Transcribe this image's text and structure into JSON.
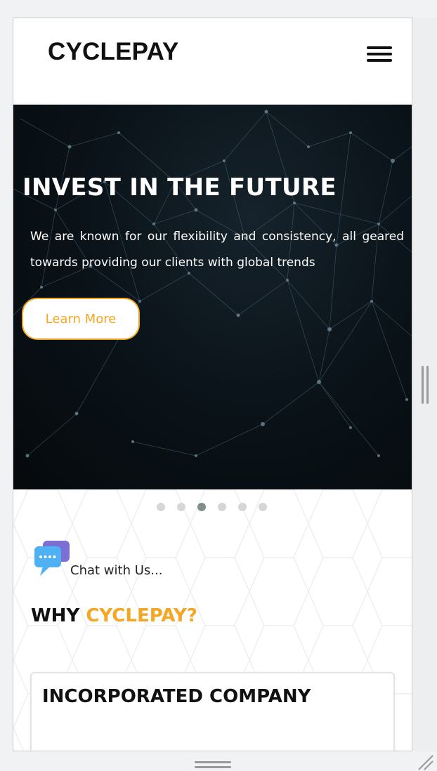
{
  "header": {
    "brand": "CYCLEPAY",
    "menu_icon": "hamburger-menu-icon"
  },
  "hero": {
    "title": "INVEST IN THE FUTURE",
    "text": "We are known for our flexibility and consistency, all geared towards providing our clients with global trends",
    "button_label": "Learn More"
  },
  "carousel": {
    "slide_count": 6,
    "active_index": 2
  },
  "chat": {
    "icon": "chat-bubbles-icon",
    "label": "Chat with Us..."
  },
  "why": {
    "prefix": "WHY ",
    "accent": "CYCLEPAY?"
  },
  "card": {
    "title": "INCORPORATED COMPANY"
  },
  "colors": {
    "accent": "#f5a623",
    "hero_bg": "#0b141a",
    "dot_active": "#7f8f8c",
    "dot_inactive": "#d4d6d8"
  }
}
